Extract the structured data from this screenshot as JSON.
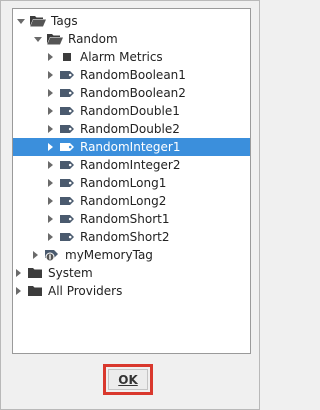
{
  "tree": {
    "items": [
      {
        "label": "Tags",
        "icon": "folder-open-icon",
        "toggle": "expanded",
        "depth": 0
      },
      {
        "label": "Random",
        "icon": "folder-open-icon",
        "toggle": "expanded",
        "depth": 1
      },
      {
        "label": "Alarm Metrics",
        "icon": "square-icon",
        "toggle": "collapsed",
        "depth": 2
      },
      {
        "label": "RandomBoolean1",
        "icon": "tag-icon",
        "toggle": "collapsed",
        "depth": 2
      },
      {
        "label": "RandomBoolean2",
        "icon": "tag-icon",
        "toggle": "collapsed",
        "depth": 2
      },
      {
        "label": "RandomDouble1",
        "icon": "tag-icon",
        "toggle": "collapsed",
        "depth": 2
      },
      {
        "label": "RandomDouble2",
        "icon": "tag-icon",
        "toggle": "collapsed",
        "depth": 2
      },
      {
        "label": "RandomInteger1",
        "icon": "tag-icon",
        "toggle": "collapsed",
        "depth": 2,
        "selected": true
      },
      {
        "label": "RandomInteger2",
        "icon": "tag-icon",
        "toggle": "collapsed",
        "depth": 2
      },
      {
        "label": "RandomLong1",
        "icon": "tag-icon",
        "toggle": "collapsed",
        "depth": 2
      },
      {
        "label": "RandomLong2",
        "icon": "tag-icon",
        "toggle": "collapsed",
        "depth": 2
      },
      {
        "label": "RandomShort1",
        "icon": "tag-icon",
        "toggle": "collapsed",
        "depth": 2
      },
      {
        "label": "RandomShort2",
        "icon": "tag-icon",
        "toggle": "collapsed",
        "depth": 2
      },
      {
        "label": "myMemoryTag",
        "icon": "memory-tag-icon",
        "toggle": "collapsed",
        "depth": 1
      },
      {
        "label": "System",
        "icon": "folder-closed-icon",
        "toggle": "collapsed",
        "depth": 0
      },
      {
        "label": "All Providers",
        "icon": "folder-closed-icon",
        "toggle": "collapsed",
        "depth": 0
      }
    ]
  },
  "footer": {
    "ok_label": "OK"
  },
  "colors": {
    "selection": "#3b8fdc",
    "highlight_outline": "#d9382d",
    "tag_icon": "#4a5a6e"
  }
}
